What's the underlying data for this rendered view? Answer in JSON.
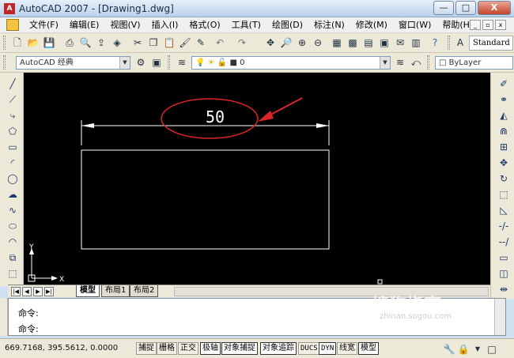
{
  "window": {
    "title": "AutoCAD 2007 - [Drawing1.dwg]",
    "app_icon_glyph": "A"
  },
  "window_controls": {
    "minimize": "—",
    "maximize": "□",
    "close": "X"
  },
  "menu": {
    "items": [
      "文件(F)",
      "编辑(E)",
      "视图(V)",
      "插入(I)",
      "格式(O)",
      "工具(T)",
      "绘图(D)",
      "标注(N)",
      "修改(M)",
      "窗口(W)",
      "帮助(H)"
    ],
    "mdi_controls": [
      "_",
      "▫",
      "x"
    ]
  },
  "toolbar1": {
    "text_style": "Standard"
  },
  "toolbar2": {
    "workspace": "AutoCAD 经典",
    "layer": "0",
    "color": "ByLayer"
  },
  "drawing": {
    "dimension_text": "50",
    "ucs_x_label": "X",
    "ucs_y_label": "Y",
    "annotation_color": "#d8252a"
  },
  "layout_tabs": [
    "模型",
    "布局1",
    "布局2"
  ],
  "command_lines": [
    "命令:",
    "命令:"
  ],
  "status": {
    "coordinates": "669.7168, 395.5612, 0.0000",
    "toggles": [
      "捕捉",
      "栅格",
      "正交",
      "极轴",
      "对象捕捉",
      "对象追踪",
      "DUCS",
      "DYN",
      "线宽",
      "模型"
    ]
  },
  "watermark": {
    "text": "搜狗指南",
    "url": "zhinan.sogou.com"
  }
}
